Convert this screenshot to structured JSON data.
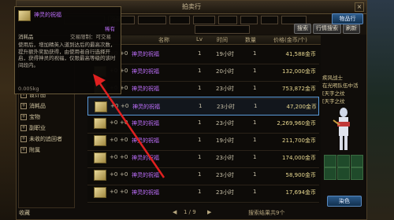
{
  "window": {
    "title": "拍卖行"
  },
  "toolbar": {
    "search_placeholder": "",
    "sort_select": "隐藏",
    "field_b": "",
    "field_c": "",
    "search_button": "搜索",
    "search_all_button": "行情搜索",
    "refresh_button": "刷新",
    "top_right_button": "物品行",
    "hidden_text": "请选择",
    "desc_label": "描述"
  },
  "sidebar": {
    "items": [
      "设计图",
      "消耗品",
      "宝物",
      "副职业",
      "未收的追回者",
      "附属"
    ],
    "bottom_label": "收藏"
  },
  "table": {
    "headers": [
      "名称",
      "Lv",
      "时间",
      "数量",
      "价格(金币/个)"
    ],
    "rows": [
      {
        "plus_a": "+0",
        "plus_b": "+0",
        "name": "神灵的祝福",
        "lvl": "1",
        "time": "19小时",
        "qty": "1",
        "price": "41,588金币",
        "selected": false
      },
      {
        "plus_a": "+0",
        "plus_b": "+0",
        "name": "神灵的祝福",
        "lvl": "1",
        "time": "20小时",
        "qty": "1",
        "price": "132,000金币",
        "selected": false
      },
      {
        "plus_a": "+0",
        "plus_b": "+0",
        "name": "神灵的祝福",
        "lvl": "1",
        "time": "23小时",
        "qty": "1",
        "price": "753,872金币",
        "selected": false
      },
      {
        "plus_a": "+0",
        "plus_b": "+0",
        "name": "神灵的祝福",
        "lvl": "1",
        "time": "23小时",
        "qty": "1",
        "price": "47,200金币",
        "selected": true
      },
      {
        "plus_a": "+0",
        "plus_b": "+0",
        "name": "神灵的祝福",
        "lvl": "1",
        "time": "23小时",
        "qty": "1",
        "price": "2,269,960金币",
        "selected": false
      },
      {
        "plus_a": "+0",
        "plus_b": "+0",
        "name": "神灵的祝福",
        "lvl": "1",
        "time": "19小时",
        "qty": "1",
        "price": "211,700金币",
        "selected": false
      },
      {
        "plus_a": "+0",
        "plus_b": "+0",
        "name": "神灵的祝福",
        "lvl": "1",
        "time": "23小时",
        "qty": "1",
        "price": "174,000金币",
        "selected": false
      },
      {
        "plus_a": "+0",
        "plus_b": "+0",
        "name": "神灵的祝福",
        "lvl": "1",
        "time": "23小时",
        "qty": "1",
        "price": "58,900金币",
        "selected": false
      },
      {
        "plus_a": "+0",
        "plus_b": "+0",
        "name": "神灵的祝福",
        "lvl": "1",
        "time": "23小时",
        "qty": "1",
        "price": "17,694金币",
        "selected": false
      }
    ]
  },
  "footer": {
    "page": "1 / 9",
    "result_text": "搜索结果共9个",
    "dye_button": "染色"
  },
  "tooltip": {
    "title": "神灵的祝福",
    "tag": "稀有",
    "type": "消耗品",
    "extra": "交易限制：可交易",
    "body": "使用后，增加精英入道到达后的最高次数，提升额外奖励获得，由使用者自行选择开启，获得神灵的祝福，仅限最高等级的该时间段内。",
    "weight": "0.005kg"
  },
  "rightpanel": {
    "lines": [
      "疾风战士",
      "在光明队伍中活",
      "[天字之纹",
      "[天字之纹"
    ]
  },
  "colors": {
    "accent": "#5a9ad8",
    "item_name": "#c070ff",
    "price": "#e8d890"
  }
}
